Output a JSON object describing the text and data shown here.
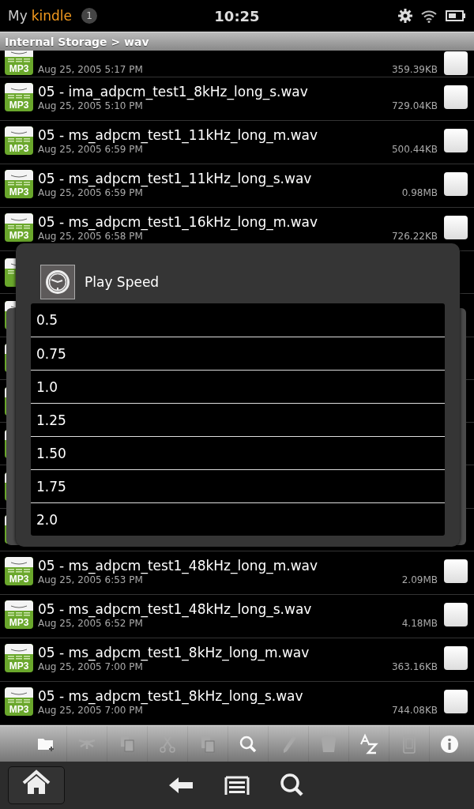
{
  "status_bar": {
    "brand_prefix": "My",
    "brand_name": "kindle",
    "notification_count": "1",
    "time": "10:25"
  },
  "breadcrumb": "Internal Storage > wav",
  "files": [
    {
      "date": "Aug 25, 2005 5:17 PM",
      "size": "359.39KB",
      "badge": "MP3",
      "checked": false,
      "partial": true
    },
    {
      "name": "05 - ima_adpcm_test1_8kHz_long_s.wav",
      "date": "Aug 25, 2005 5:10 PM",
      "size": "729.04KB",
      "badge": "MP3",
      "checked": false
    },
    {
      "name": "05 - ms_adpcm_test1_11kHz_long_m.wav",
      "date": "Aug 25, 2005 6:59 PM",
      "size": "500.44KB",
      "badge": "MP3",
      "checked": false
    },
    {
      "name": "05 - ms_adpcm_test1_11kHz_long_s.wav",
      "date": "Aug 25, 2005 6:59 PM",
      "size": "0.98MB",
      "badge": "MP3",
      "checked": false
    },
    {
      "name": "05 - ms_adpcm_test1_16kHz_long_m.wav",
      "date": "Aug 25, 2005 6:58 PM",
      "size": "726.22KB",
      "badge": "MP3",
      "checked": false
    },
    {
      "name": "05 - ms_adpcm_test1_48kHz_long_m.wav",
      "date": "Aug 25, 2005 6:53 PM",
      "size": "2.09MB",
      "badge": "MP3",
      "checked": false,
      "after_dialog": true
    },
    {
      "name": "05 - ms_adpcm_test1_48kHz_long_s.wav",
      "date": "Aug 25, 2005 6:52 PM",
      "size": "4.18MB",
      "badge": "MP3",
      "checked": false
    },
    {
      "name": "05 - ms_adpcm_test1_8kHz_long_m.wav",
      "date": "Aug 25, 2005 7:00 PM",
      "size": "363.16KB",
      "badge": "MP3",
      "checked": false
    },
    {
      "name": "05 - ms_adpcm_test1_8kHz_long_s.wav",
      "date": "Aug 25, 2005 7:00 PM",
      "size": "744.08KB",
      "badge": "MP3",
      "checked": false
    }
  ],
  "dialog": {
    "title": "Play Speed",
    "options": [
      "0.5",
      "0.75",
      "1.0",
      "1.25",
      "1.50",
      "1.75",
      "2.0"
    ]
  },
  "toolbar": [
    {
      "kind": "new-folder",
      "disabled": false
    },
    {
      "kind": "share",
      "disabled": true
    },
    {
      "kind": "copy",
      "disabled": true
    },
    {
      "kind": "cut",
      "disabled": true
    },
    {
      "kind": "paste",
      "disabled": true
    },
    {
      "kind": "search",
      "disabled": false
    },
    {
      "kind": "rename",
      "disabled": true
    },
    {
      "kind": "delete",
      "disabled": true
    },
    {
      "kind": "sort",
      "disabled": false
    },
    {
      "kind": "device",
      "disabled": true
    },
    {
      "kind": "info",
      "disabled": false
    }
  ],
  "nav": [
    {
      "kind": "home"
    },
    {
      "kind": "back"
    },
    {
      "kind": "menu"
    },
    {
      "kind": "search"
    }
  ]
}
